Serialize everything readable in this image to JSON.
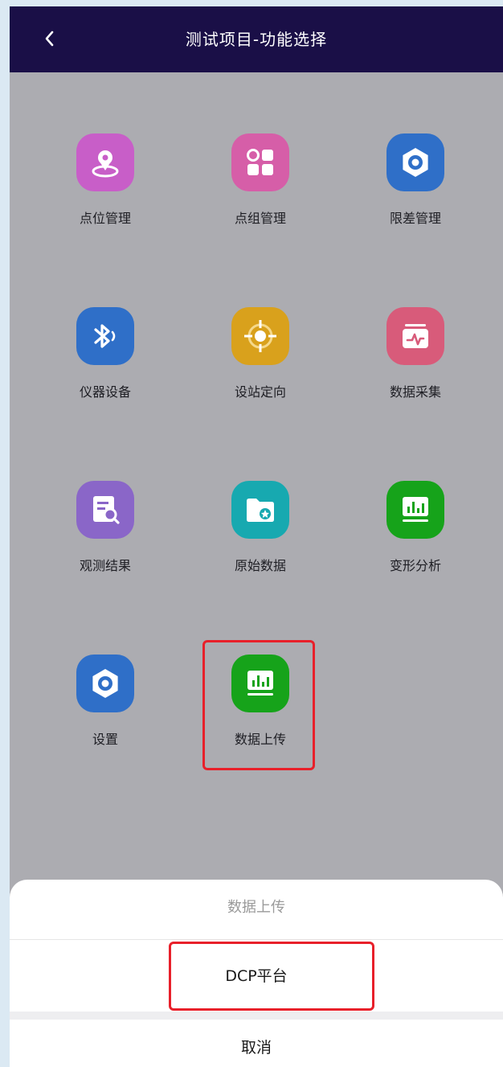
{
  "header": {
    "back_icon": "chevron-left-icon",
    "title": "测试项目-功能选择"
  },
  "menu": {
    "items": [
      {
        "label": "点位管理",
        "icon": "map-pin-icon",
        "color": "#c85ec8"
      },
      {
        "label": "点组管理",
        "icon": "grid-icon",
        "color": "#d65ea8"
      },
      {
        "label": "限差管理",
        "icon": "gear-icon",
        "color": "#2f6fc8"
      },
      {
        "label": "仪器设备",
        "icon": "bluetooth-icon",
        "color": "#2f6fc8"
      },
      {
        "label": "设站定向",
        "icon": "crosshair-icon",
        "color": "#d9a11c"
      },
      {
        "label": "数据采集",
        "icon": "wave-icon",
        "color": "#d85b7a"
      },
      {
        "label": "观测结果",
        "icon": "report-icon",
        "color": "#8a66c8"
      },
      {
        "label": "原始数据",
        "icon": "folder-icon",
        "color": "#17a9b0"
      },
      {
        "label": "变形分析",
        "icon": "chart-icon",
        "color": "#16a31a"
      },
      {
        "label": "设置",
        "icon": "gear-icon",
        "color": "#2f6fc8"
      },
      {
        "label": "数据上传",
        "icon": "chart-icon",
        "color": "#16a31a"
      }
    ]
  },
  "action_sheet": {
    "title": "数据上传",
    "option": "DCP平台",
    "cancel": "取消"
  },
  "highlight_color": "#e8202a"
}
